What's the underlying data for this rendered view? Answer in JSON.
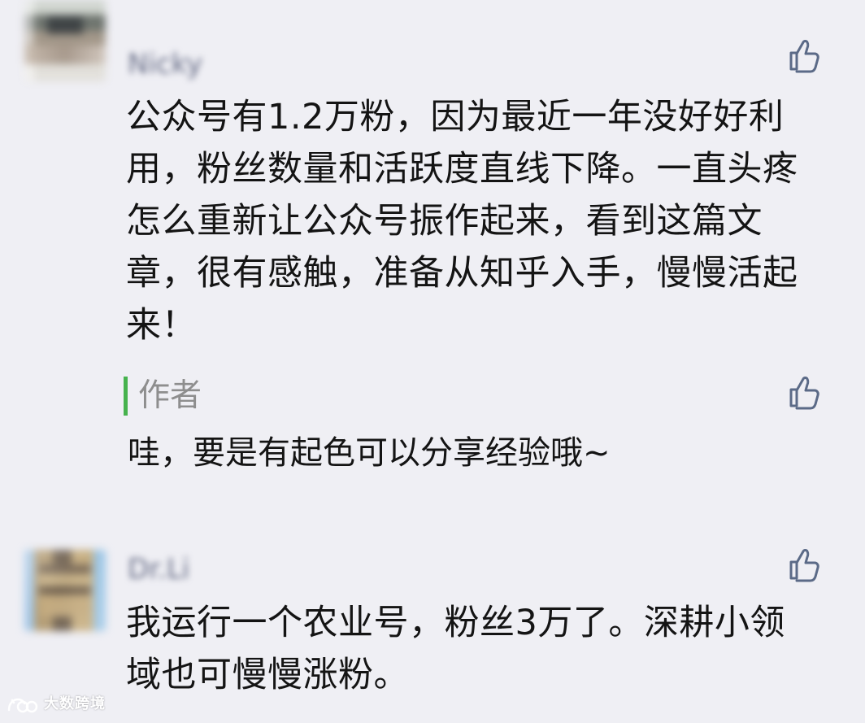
{
  "comments": [
    {
      "name": "Nicky",
      "text": "公众号有1.2万粉，因为最近一年没好好利用，粉丝数量和活跃度直线下降。一直头疼怎么重新让公众号振作起来，看到这篇文章，很有感触，准备从知乎入手，慢慢活起来！",
      "reply": {
        "author": "作者",
        "text": "哇，要是有起色可以分享经验哦~"
      }
    },
    {
      "name": "Dr.Li",
      "text": "我运行一个农业号，粉丝3万了。深耕小领域也可慢慢涨粉。"
    }
  ],
  "icons": {
    "like": "thumb-up-icon",
    "logo": "watermark-logo-icon"
  },
  "colors": {
    "background": "#efeff4",
    "icon": "#5b6a87",
    "reply_bar": "#46b24d",
    "author": "#8e8e8e",
    "text": "#141414"
  },
  "watermark": {
    "label": "大数跨境"
  }
}
